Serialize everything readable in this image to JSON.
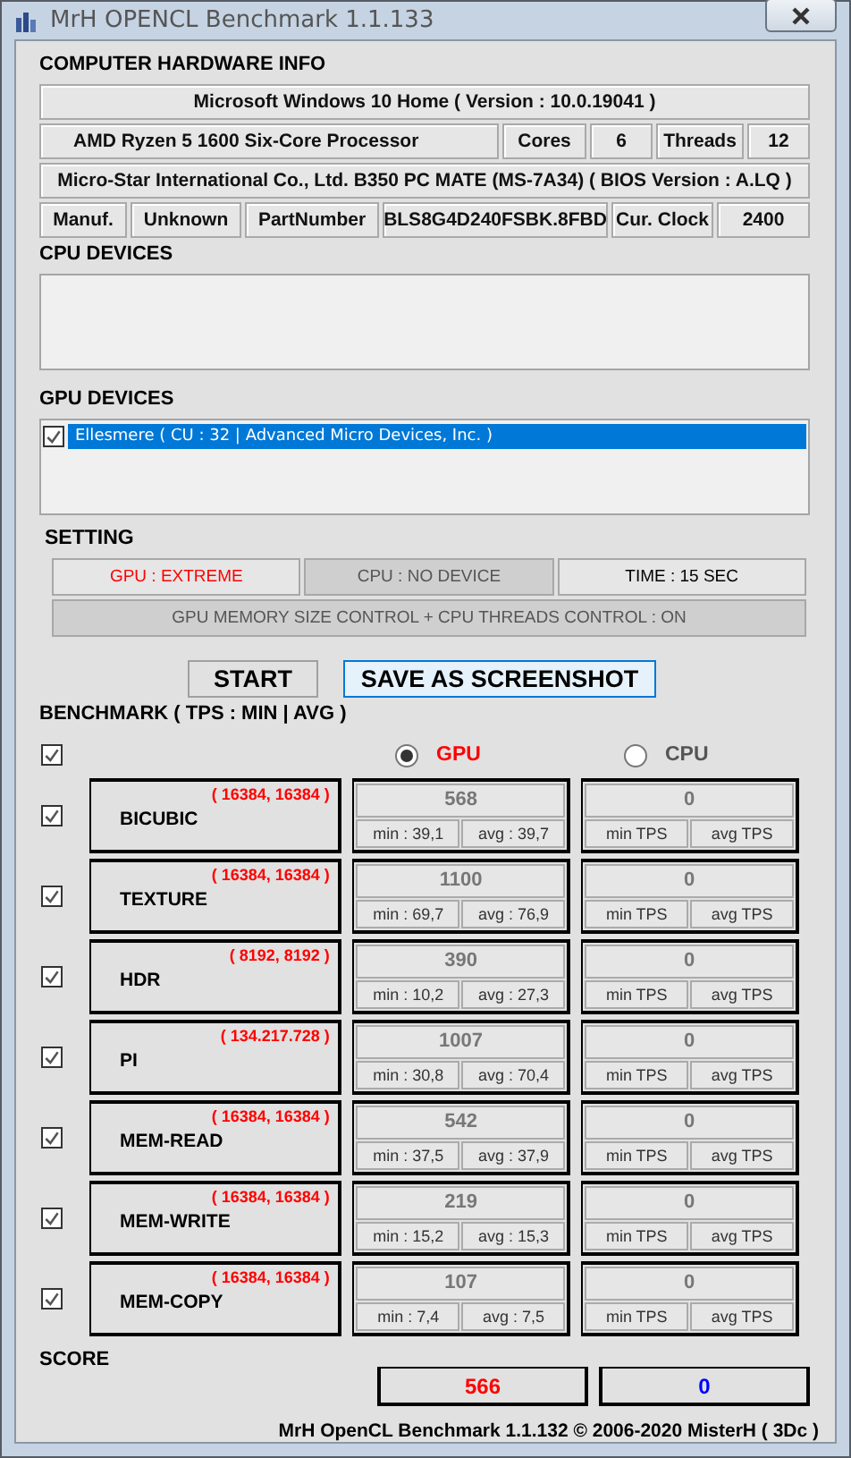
{
  "window": {
    "title": "MrH OPENCL Benchmark 1.1.133"
  },
  "hardware": {
    "title": "COMPUTER HARDWARE INFO",
    "os": "Microsoft Windows 10 Home ( Version : 10.0.19041 )",
    "cpu": {
      "model": "AMD Ryzen 5 1600 Six-Core Processor",
      "cores_label": "Cores",
      "cores": "6",
      "threads_label": "Threads",
      "threads": "12"
    },
    "board": "Micro-Star International Co., Ltd. B350 PC MATE (MS-7A34) ( BIOS Version : A.LQ )",
    "memory": {
      "manufacturer_label": "Manuf.",
      "manufacturer": "Unknown",
      "part_label": "PartNumber",
      "part": "BLS8G4D240FSBK.8FBD",
      "clock_label": "Cur. Clock",
      "clock": "2400"
    }
  },
  "cpu_devices": {
    "title": "CPU DEVICES"
  },
  "gpu_devices": {
    "title": "GPU DEVICES",
    "items": [
      {
        "label": "Ellesmere ( CU : 32 | Advanced Micro Devices, Inc. )",
        "checked": true,
        "selected": true
      }
    ]
  },
  "setting": {
    "title": "SETTING",
    "items": [
      {
        "text": "GPU : EXTREME",
        "kind": "alert"
      },
      {
        "text": "CPU : NO DEVICE",
        "kind": "inactive"
      },
      {
        "text": "TIME : 15 SEC",
        "kind": "normal"
      },
      {
        "text": "GPU MEMORY SIZE CONTROL + CPU THREADS CONTROL : ON",
        "kind": "inactive"
      }
    ]
  },
  "buttons": [
    {
      "label": "START",
      "focused": false
    },
    {
      "label": "SAVE AS SCREENSHOT",
      "focused": true
    }
  ],
  "benchmark": {
    "title": "BENCHMARK ( TPS : MIN | AVG )",
    "all_checked": true,
    "devices": [
      {
        "label": "GPU",
        "selected": true
      },
      {
        "label": "CPU",
        "selected": false
      }
    ],
    "tests": [
      {
        "name": "BICUBIC",
        "size": "( 16384, 16384 )",
        "checked": true,
        "gpu": {
          "tps": "568",
          "min": "min : 39,1",
          "avg": "avg : 39,7"
        },
        "cpu": {
          "tps": "0",
          "min": "min TPS",
          "avg": "avg TPS"
        }
      },
      {
        "name": "TEXTURE",
        "size": "( 16384, 16384 )",
        "checked": true,
        "gpu": {
          "tps": "1100",
          "min": "min : 69,7",
          "avg": "avg : 76,9"
        },
        "cpu": {
          "tps": "0",
          "min": "min TPS",
          "avg": "avg TPS"
        }
      },
      {
        "name": "HDR",
        "size": "( 8192, 8192 )",
        "checked": true,
        "gpu": {
          "tps": "390",
          "min": "min : 10,2",
          "avg": "avg : 27,3"
        },
        "cpu": {
          "tps": "0",
          "min": "min TPS",
          "avg": "avg TPS"
        }
      },
      {
        "name": "PI",
        "size": "( 134.217.728 )",
        "checked": true,
        "gpu": {
          "tps": "1007",
          "min": "min : 30,8",
          "avg": "avg : 70,4"
        },
        "cpu": {
          "tps": "0",
          "min": "min TPS",
          "avg": "avg TPS"
        }
      },
      {
        "name": "MEM-READ",
        "size": "( 16384, 16384 )",
        "checked": true,
        "gpu": {
          "tps": "542",
          "min": "min : 37,5",
          "avg": "avg : 37,9"
        },
        "cpu": {
          "tps": "0",
          "min": "min TPS",
          "avg": "avg TPS"
        }
      },
      {
        "name": "MEM-WRITE",
        "size": "( 16384, 16384 )",
        "checked": true,
        "gpu": {
          "tps": "219",
          "min": "min : 15,2",
          "avg": "avg : 15,3"
        },
        "cpu": {
          "tps": "0",
          "min": "min TPS",
          "avg": "avg TPS"
        }
      },
      {
        "name": "MEM-COPY",
        "size": "( 16384, 16384 )",
        "checked": true,
        "gpu": {
          "tps": "107",
          "min": "min : 7,4",
          "avg": "avg : 7,5"
        },
        "cpu": {
          "tps": "0",
          "min": "min TPS",
          "avg": "avg TPS"
        }
      }
    ]
  },
  "score": {
    "title": "SCORE",
    "gpu": "566",
    "cpu": "0"
  },
  "footer": "MrH OpenCL Benchmark 1.1.132 © 2006-2020 MisterH ( 3Dc )"
}
